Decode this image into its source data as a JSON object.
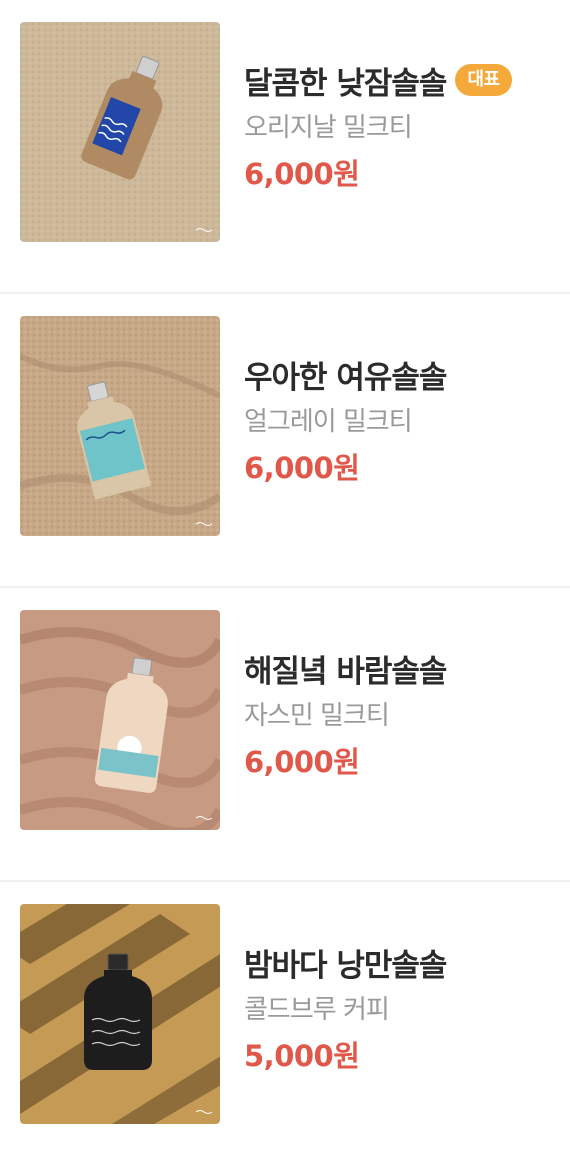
{
  "products": [
    {
      "title": "달콤한 낮잠솔솔",
      "badge": "대표",
      "subtitle": "오리지날 밀크티",
      "price": "6,000원",
      "image_icon": "milk-tea-bottle-on-sand",
      "badge_color": "#f5a93a"
    },
    {
      "title": "우아한 여유솔솔",
      "subtitle": "얼그레이 밀크티",
      "price": "6,000원",
      "image_icon": "earl-grey-bottle-in-sand"
    },
    {
      "title": "해질녘 바람솔솔",
      "subtitle": "자스민 밀크티",
      "price": "6,000원",
      "image_icon": "jasmine-bottle-on-dunes"
    },
    {
      "title": "밤바다 낭만솔솔",
      "subtitle": "콜드브루 커피",
      "price": "5,000원",
      "image_icon": "cold-brew-bottle-shadows"
    }
  ],
  "colors": {
    "title": "#2b2b2b",
    "subtitle": "#9a9a9a",
    "price": "#e0584a",
    "divider": "#f0f0f0"
  }
}
